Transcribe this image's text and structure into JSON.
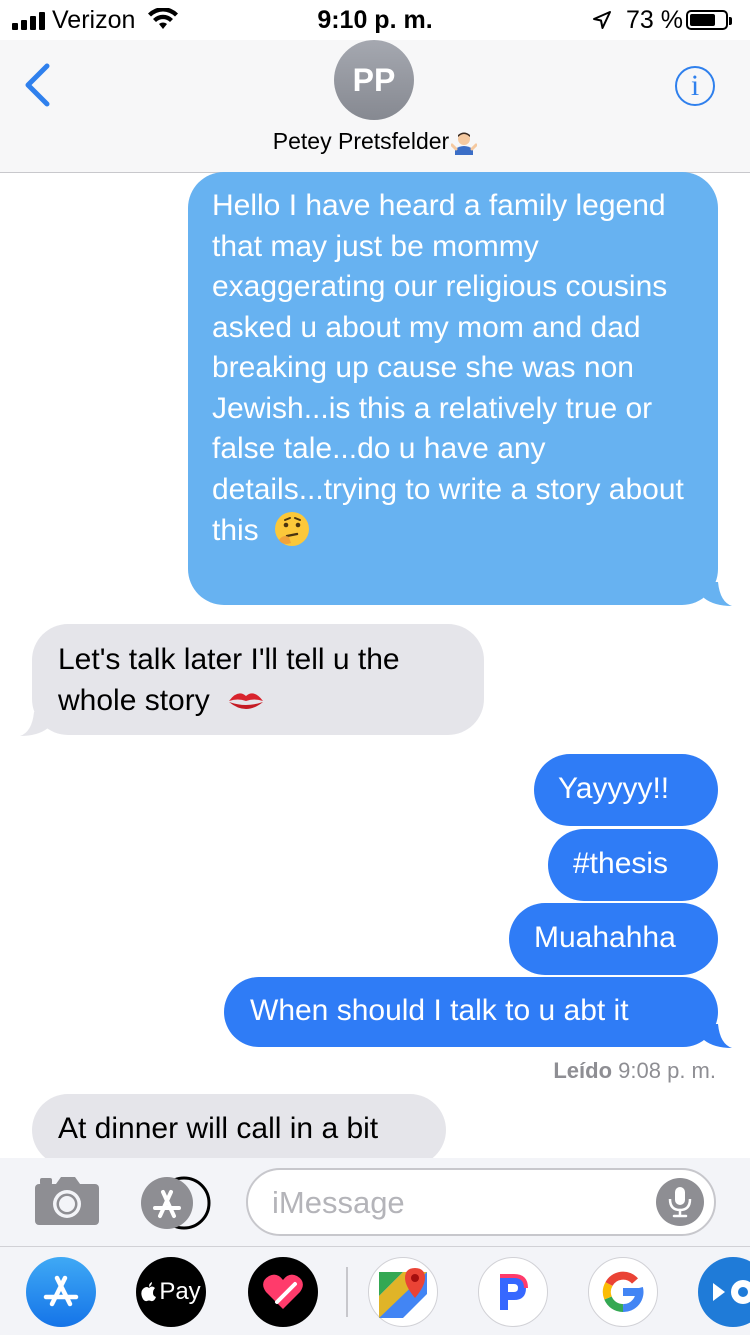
{
  "status": {
    "carrier": "Verizon",
    "time": "9:10 p. m.",
    "battery_percent": "73 %",
    "battery_level": 0.73
  },
  "header": {
    "avatar_initials": "PP",
    "contact_name": "Petey Pretsfelder",
    "contact_emoji_icon": "person-shrugging-icon"
  },
  "messages": [
    {
      "from": "me",
      "text": "Hello I have heard a family legend that may just be mommy exaggerating our religious cousins asked u about my mom and dad breaking up cause she was non Jewish...is this a relatively true or false tale...do u have any details...trying to write a story about this",
      "emoji": "thinking-face-icon"
    },
    {
      "from": "them",
      "text": "Let's talk later I'll tell u the whole story",
      "emoji": "kiss-mark-icon"
    },
    {
      "from": "me",
      "text": "Yayyyy!!"
    },
    {
      "from": "me",
      "text": "#thesis"
    },
    {
      "from": "me",
      "text": "Muahahha"
    },
    {
      "from": "me",
      "text": "When should I talk to u abt it"
    },
    {
      "from": "them",
      "text": "At dinner will call in a bit"
    }
  ],
  "read_receipt": {
    "label": "Leído",
    "time": "9:08 p. m."
  },
  "composer": {
    "placeholder": "iMessage"
  },
  "colors": {
    "sent_bubble": "#2f7cf6",
    "sent_bubble_light": "#67b2f1",
    "received_bubble": "#e5e5ea",
    "accent": "#2f80ed"
  },
  "app_drawer": [
    {
      "name": "app-store-icon"
    },
    {
      "name": "apple-pay-icon",
      "label": "Pay"
    },
    {
      "name": "digital-touch-icon"
    },
    {
      "name": "google-maps-icon"
    },
    {
      "name": "pandora-icon"
    },
    {
      "name": "google-icon"
    },
    {
      "name": "tripadvisor-icon"
    }
  ]
}
